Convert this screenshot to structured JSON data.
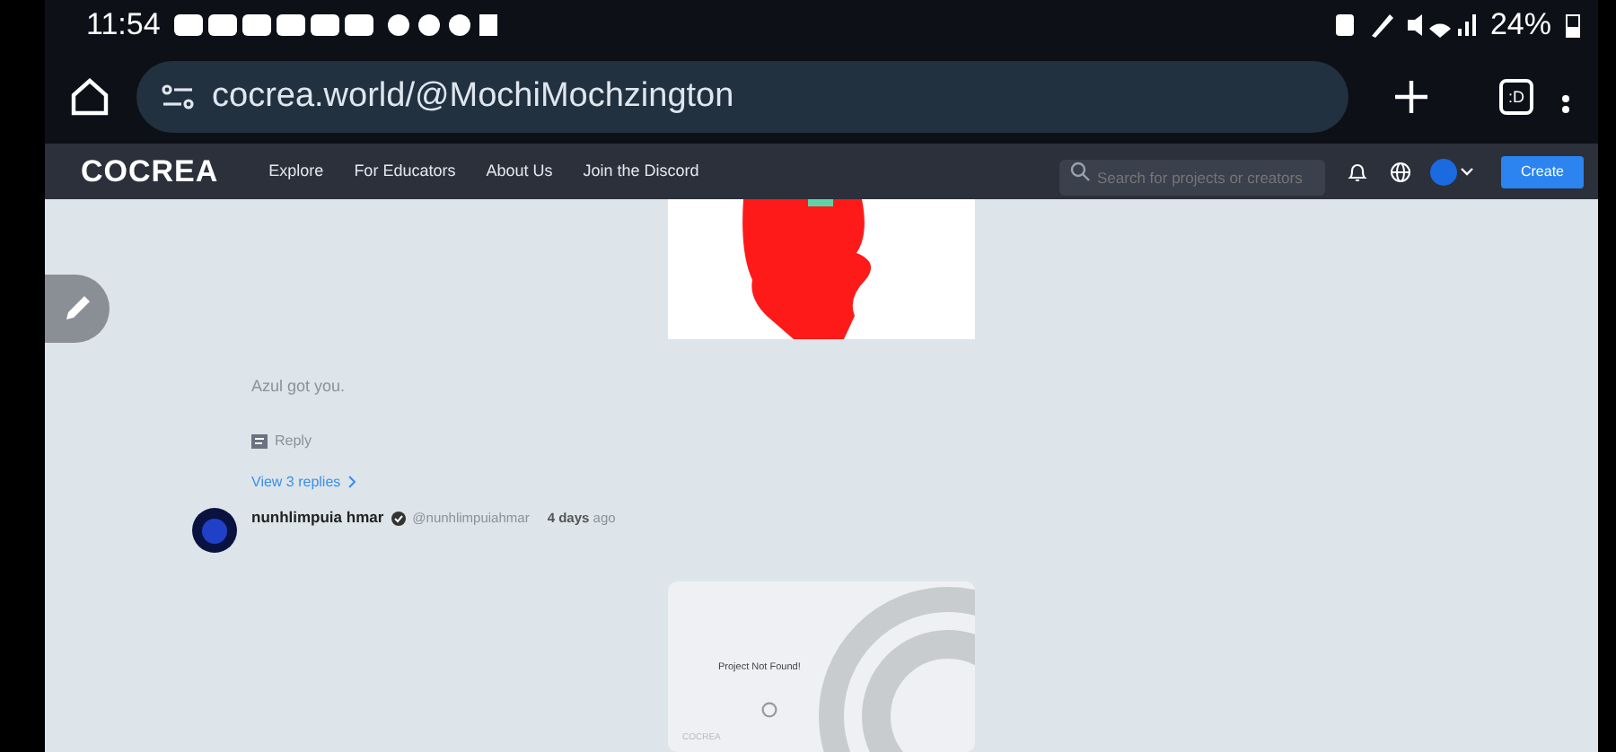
{
  "status_bar": {
    "time": "11:54",
    "battery": "24%"
  },
  "browser": {
    "url": "cocrea.world/@MochiMochzington",
    "tab_count": ":D"
  },
  "navbar": {
    "logo": "COCREA",
    "links": [
      "Explore",
      "For Educators",
      "About Us",
      "Join the Discord"
    ],
    "search": {
      "placeholder": "Search for projects or creators"
    },
    "create": "Create"
  },
  "comment": {
    "text": "Azul got you.",
    "reply": "Reply",
    "view_replies": "View 3 replies"
  },
  "next_comment": {
    "author": "nunhlimpuia hmar",
    "handle": "@nunhlimpuiahmar",
    "time_bold": "4 days",
    "time_rest": "ago"
  },
  "project_card": {
    "message": "Project Not Found!",
    "footer": "COCREA"
  }
}
